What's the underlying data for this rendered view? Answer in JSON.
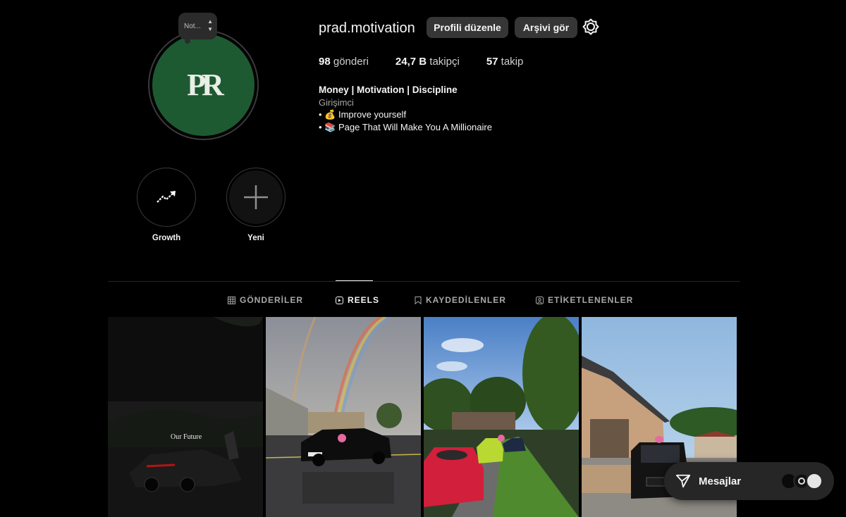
{
  "profile": {
    "note": "Not...",
    "avatar_monogram": "PR",
    "username": "prad.motivation",
    "edit_button": "Profili düzenle",
    "archive_button": "Arşivi gör",
    "stats": {
      "posts_count": "98",
      "posts_label": "gönderi",
      "followers_count": "24,7 B",
      "followers_label": "takipçi",
      "following_count": "57",
      "following_label": "takip"
    },
    "bio": {
      "name": "Money | Motivation | Discipline",
      "category": "Girişimci",
      "line1": "• 💰 Improve yourself",
      "line2": "• 📚 Page That Will Make You A Millionaire"
    }
  },
  "highlights": [
    {
      "label": "Growth",
      "icon": "trend-up-icon"
    },
    {
      "label": "Yeni",
      "icon": "plus-icon"
    }
  ],
  "tabs": [
    {
      "label": "GÖNDERİLER",
      "icon": "grid-icon",
      "active": false
    },
    {
      "label": "REELS",
      "icon": "reels-icon",
      "active": true
    },
    {
      "label": "KAYDEDİLENLER",
      "icon": "bookmark-icon",
      "active": false
    },
    {
      "label": "ETİKETLENENLER",
      "icon": "tagged-icon",
      "active": false
    }
  ],
  "reels": [
    {
      "caption": "Our Future",
      "scene": "supercar-night"
    },
    {
      "caption": "",
      "scene": "audi-rainbow"
    },
    {
      "caption": "",
      "scene": "porsche-street"
    },
    {
      "caption": "",
      "scene": "g-wagon-garage"
    }
  ],
  "messages": {
    "label": "Mesajlar"
  },
  "colors": {
    "background": "#000000",
    "button": "#363636",
    "avatar_green": "#1d5a32",
    "muted_text": "#a8a8a8"
  }
}
